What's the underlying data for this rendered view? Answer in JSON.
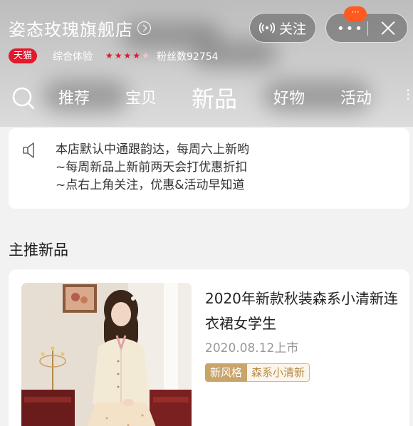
{
  "header": {
    "store_name": "姿态玫瑰旗舰店",
    "badge": "天猫",
    "experience_label": "综合体验",
    "rating_stars": 4,
    "rating_max": 5,
    "fans": "粉丝数92754",
    "follow_label": "关注",
    "more_label": "•••",
    "notification_count": "···"
  },
  "tabs": [
    {
      "label": "推荐"
    },
    {
      "label": "宝贝"
    },
    {
      "label": "新品",
      "active": true
    },
    {
      "label": "好物"
    },
    {
      "label": "活动"
    }
  ],
  "notice": {
    "lines": [
      "本店默认中通跟韵达，每周六上新哟",
      "~每周新品上新前两天会打优惠折扣",
      "~点右上角关注，优惠&活动早知道"
    ]
  },
  "section": {
    "title": "主推新品"
  },
  "product": {
    "title": "2020年新款秋装森系小清新连衣裙女学生",
    "date": "2020.08.12上市",
    "tags": [
      "新风格",
      "森系小清新"
    ]
  },
  "colors": {
    "tmall_red": "#e4172d",
    "badge_orange": "#ff5a1f",
    "tag_gold": "#c9a56a"
  },
  "icons": [
    "search-icon",
    "live-icon",
    "speaker-icon",
    "close-icon",
    "chevron-right-icon"
  ]
}
